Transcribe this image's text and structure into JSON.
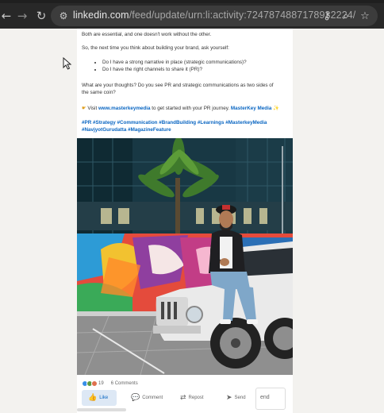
{
  "browser": {
    "url_host": "linkedin.com",
    "url_path": "/feed/update/urn:li:activity:7247874887178932224/",
    "icons": [
      "back-icon",
      "forward-icon",
      "reload-icon",
      "site-settings-icon",
      "password-key-icon",
      "zoom-icon",
      "bookmark-star-icon"
    ]
  },
  "post": {
    "para1": "Both are essential, and one doesn't work without the other.",
    "para2": "So, the next time you think about building your brand, ask yourself:",
    "bullets": [
      "Do I have a strong narrative in place (strategic communications)?",
      "Do I have the right channels to share it (PR)?"
    ],
    "para3": "What are your thoughts? Do you see PR and strategic communications as two sides of the same coin?",
    "cta_prefix": "Visit",
    "cta_link": "www.masterkeymedia",
    "cta_middle": "to get started with your PR journey.",
    "cta_brand": "MasterKey Media",
    "hashtags": "#PR #Strategy #Communication #BrandBuilding #Learnings #MasterkeyMedia #NavjyotGurudatta #MagazineFeature"
  },
  "social": {
    "reaction_count": "19",
    "comments": "6 Comments"
  },
  "actions": {
    "like": "Like",
    "comment": "Comment",
    "repost": "Repost",
    "send": "Send"
  },
  "send_box_text": "end",
  "colors": {
    "link_blue": "#0a66c2",
    "toolbar_bg": "#282828"
  }
}
